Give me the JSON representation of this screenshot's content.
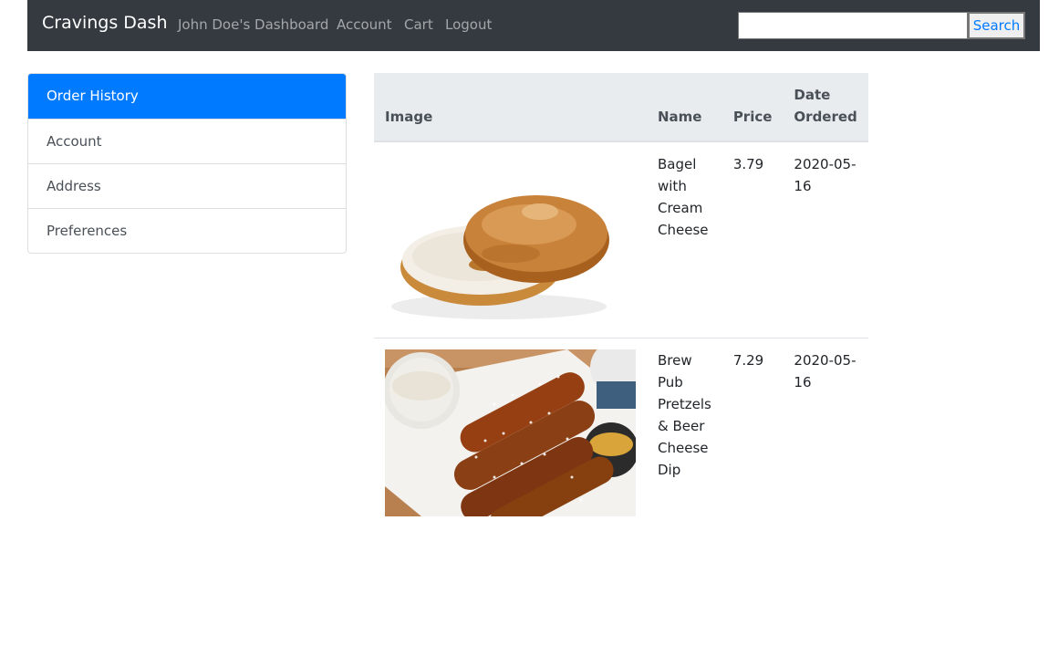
{
  "navbar": {
    "brand": "Cravings Dash",
    "links": [
      "John Doe's Dashboard",
      "Account",
      "Cart",
      "Logout"
    ],
    "search_placeholder": "",
    "search_button": "Search",
    "bg_color": "#343a40"
  },
  "sidebar": {
    "items": [
      {
        "label": "Order History",
        "active": true
      },
      {
        "label": "Account",
        "active": false
      },
      {
        "label": "Address",
        "active": false
      },
      {
        "label": "Preferences",
        "active": false
      }
    ],
    "active_color": "#007bff"
  },
  "orders": {
    "headers": [
      "Image",
      "Name",
      "Price",
      "Date Ordered"
    ],
    "rows": [
      {
        "image": "bagel-with-cream-cheese-photo",
        "name": "Bagel with Cream Cheese",
        "price": "3.79",
        "date": "2020-05-16"
      },
      {
        "image": "pretzels-and-beer-cheese-dip-photo",
        "name": "Brew Pub Pretzels & Beer Cheese Dip",
        "price": "7.29",
        "date": "2020-05-16"
      }
    ]
  }
}
